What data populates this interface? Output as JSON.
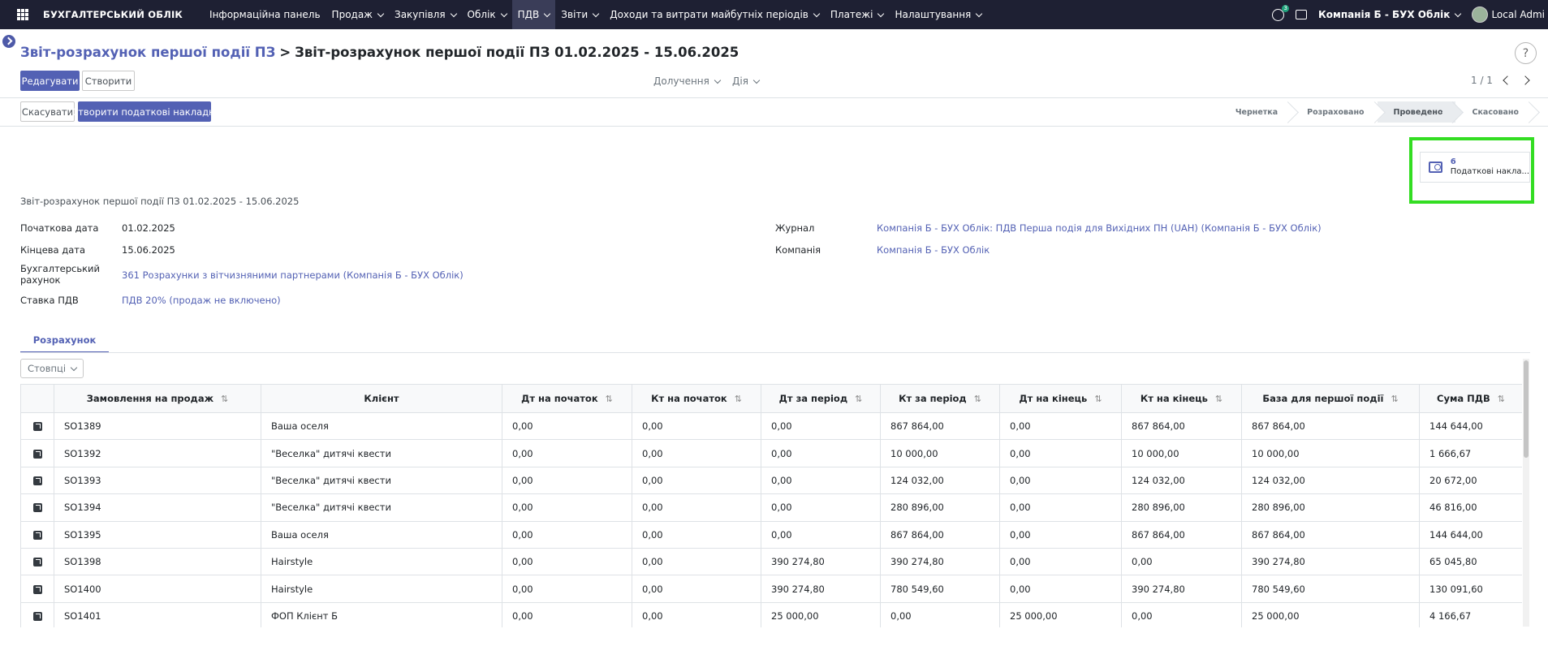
{
  "nav": {
    "brand": "БУХГАЛТЕРСЬКИЙ ОБЛІК",
    "menu": [
      {
        "label": "Інформаційна панель",
        "dropdown": false
      },
      {
        "label": "Продаж",
        "dropdown": true
      },
      {
        "label": "Закупівля",
        "dropdown": true
      },
      {
        "label": "Облік",
        "dropdown": true
      },
      {
        "label": "ПДВ",
        "dropdown": true,
        "active": true
      },
      {
        "label": "Звіти",
        "dropdown": true
      },
      {
        "label": "Доходи та витрати майбутніх періодів",
        "dropdown": true
      },
      {
        "label": "Платежі",
        "dropdown": true
      },
      {
        "label": "Налаштування",
        "dropdown": true
      }
    ],
    "activity_badge": "3",
    "company": "Компанія Б - БУХ Облік",
    "user": "Local Admi"
  },
  "breadcrumb": {
    "parent": "Звіт-розрахунок першої події ПЗ",
    "current": "Звіт-розрахунок першої події ПЗ 01.02.2025 - 15.06.2025"
  },
  "help_label": "?",
  "actions": {
    "edit": "Редагувати",
    "create": "Створити",
    "attachments": "Долучення",
    "action": "Дія",
    "pager": "1 / 1"
  },
  "header_buttons": {
    "cancel": "Скасувати",
    "create_invoices": "Створити податкові накладні"
  },
  "stages": [
    {
      "label": "Чернетка",
      "active": false
    },
    {
      "label": "Розраховано",
      "active": false
    },
    {
      "label": "Проведено",
      "active": true
    },
    {
      "label": "Скасовано",
      "active": false
    }
  ],
  "smart_button": {
    "count": "6",
    "label": "Податкові накла..."
  },
  "form": {
    "title": "Звіт-розрахунок першої події ПЗ 01.02.2025 - 15.06.2025",
    "start_date_label": "Початкова дата",
    "start_date": "01.02.2025",
    "end_date_label": "Кінцева дата",
    "end_date": "15.06.2025",
    "account_label": "Бухгалтерський рахунок",
    "account": "361 Розрахунки з вітчизняними партнерами (Компанія Б - БУХ Облік)",
    "vat_label": "Ставка ПДВ",
    "vat": "ПДВ 20% (продаж не включено)",
    "journal_label": "Журнал",
    "journal": "Компанія Б - БУХ Облік: ПДВ Перша подія для Вихідних ПН (UAH) (Компанія Б - БУХ Облік)",
    "company_label": "Компанія",
    "company": "Компанія Б - БУХ Облік"
  },
  "tab": "Розрахунок",
  "columns_button": "Стовпці",
  "table": {
    "columns": [
      "Замовлення на продаж",
      "Клієнт",
      "Дт на початок",
      "Кт на початок",
      "Дт за період",
      "Кт за період",
      "Дт на кінець",
      "Кт на кінець",
      "База для першої події",
      "Сума ПДВ"
    ],
    "rows": [
      [
        "SO1389",
        "Ваша оселя",
        "0,00",
        "0,00",
        "0,00",
        "867 864,00",
        "0,00",
        "867 864,00",
        "867 864,00",
        "144 644,00"
      ],
      [
        "SO1392",
        "\"Веселка\" дитячі квести",
        "0,00",
        "0,00",
        "0,00",
        "10 000,00",
        "0,00",
        "10 000,00",
        "10 000,00",
        "1 666,67"
      ],
      [
        "SO1393",
        "\"Веселка\" дитячі квести",
        "0,00",
        "0,00",
        "0,00",
        "124 032,00",
        "0,00",
        "124 032,00",
        "124 032,00",
        "20 672,00"
      ],
      [
        "SO1394",
        "\"Веселка\" дитячі квести",
        "0,00",
        "0,00",
        "0,00",
        "280 896,00",
        "0,00",
        "280 896,00",
        "280 896,00",
        "46 816,00"
      ],
      [
        "SO1395",
        "Ваша оселя",
        "0,00",
        "0,00",
        "0,00",
        "867 864,00",
        "0,00",
        "867 864,00",
        "867 864,00",
        "144 644,00"
      ],
      [
        "SO1398",
        "Hairstyle",
        "0,00",
        "0,00",
        "390 274,80",
        "390 274,80",
        "0,00",
        "0,00",
        "390 274,80",
        "65 045,80"
      ],
      [
        "SO1400",
        "Hairstyle",
        "0,00",
        "0,00",
        "390 274,80",
        "780 549,60",
        "0,00",
        "390 274,80",
        "780 549,60",
        "130 091,60"
      ],
      [
        "SO1401",
        "ФОП Клієнт Б",
        "0,00",
        "0,00",
        "25 000,00",
        "0,00",
        "25 000,00",
        "0,00",
        "25 000,00",
        "4 166,67"
      ]
    ]
  },
  "colors": {
    "nav_bg": "#1e2033",
    "accent": "#5361b4",
    "highlight": "#33dd22"
  }
}
